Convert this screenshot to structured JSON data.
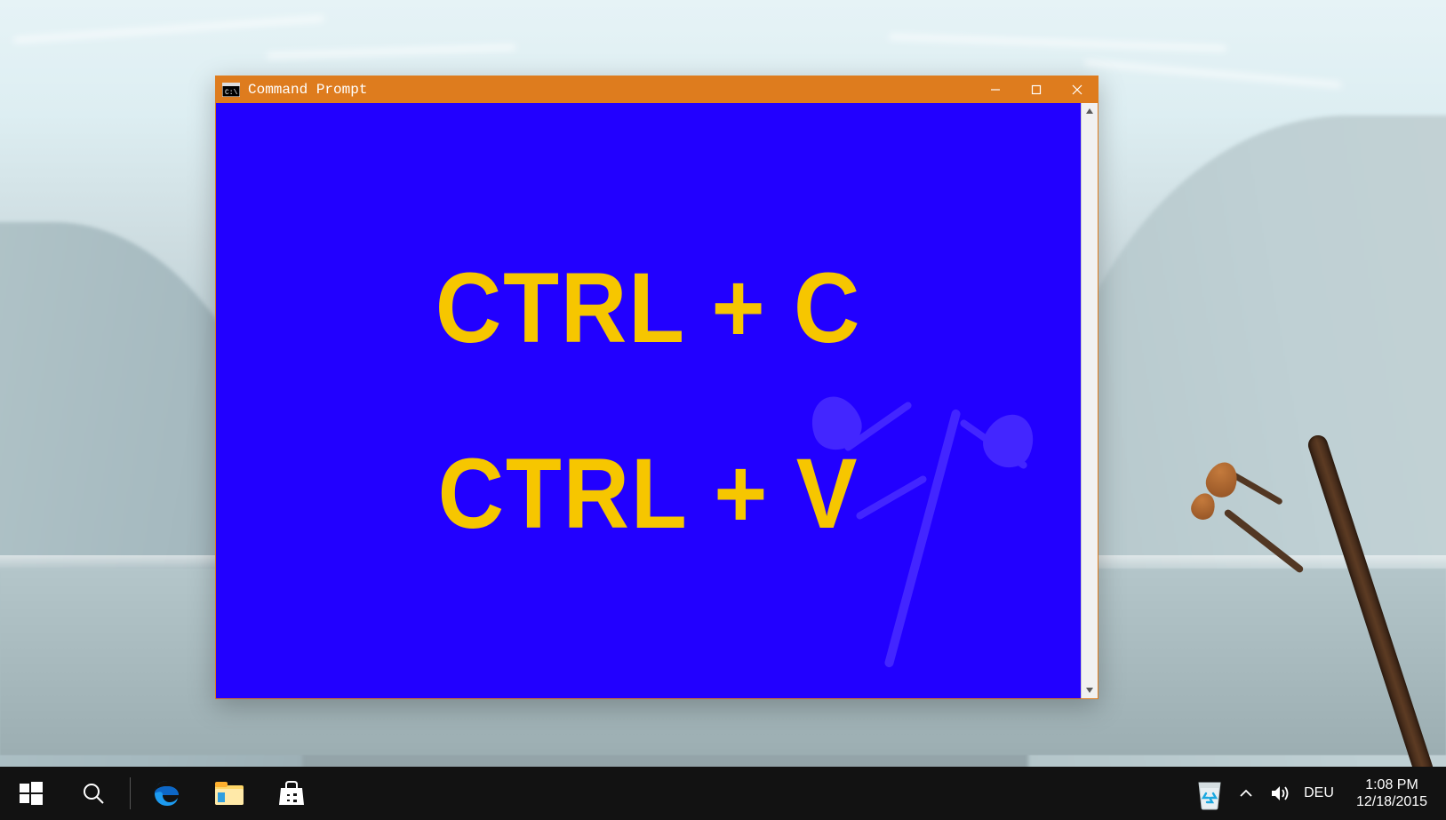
{
  "window": {
    "title": "Command Prompt",
    "content_line1": "CTRL + C",
    "content_line2": "CTRL + V"
  },
  "taskbar": {
    "language": "DEU",
    "time": "1:08 PM",
    "date": "12/18/2015"
  }
}
